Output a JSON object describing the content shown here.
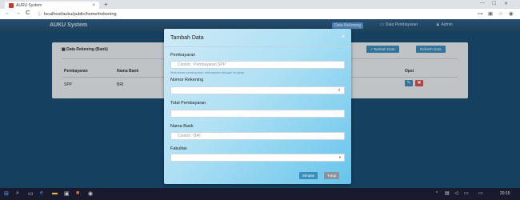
{
  "browser": {
    "tab_title": "AURU System",
    "tab_close": "×",
    "new_tab": "+",
    "url": "localhost/auku/public/home#rekening",
    "nav_back": "←",
    "nav_forward": "→",
    "nav_reload": "C"
  },
  "app": {
    "brand": "AUKU System",
    "nav": {
      "item1": "Data Rekening",
      "item2": "Data Pembayaran",
      "item3": "Admin"
    }
  },
  "panel": {
    "title": "Data Rekening (Bank)",
    "add_button": "+ Tambah Data",
    "refresh_button": "Refresh Data",
    "columns": [
      "Pembayaran",
      "Nama Bank",
      "Opsi"
    ],
    "rows": [
      {
        "pembayaran": "SPP",
        "bank": "BRI"
      }
    ]
  },
  "modal": {
    "title": "Tambah Data",
    "close": "×",
    "pembayaran_label": "Pembayaran",
    "pembayaran_placeholder": "Contoh : Pembayaran SPP",
    "pembayaran_help": "Masukkan pembayaran mahasiswa dengan lengkap",
    "rekening_label": "Nomor Rekening",
    "rekening_value": "",
    "total_label": "Total Pembayaran",
    "bank_label": "Nama Bank",
    "bank_placeholder": "Contoh : BRI",
    "fakultas_label": "Fakultas",
    "save_button": "Simpan",
    "close_button": "Tutup"
  },
  "taskbar": {
    "time": "20:15"
  },
  "colors": {
    "page_bg": "#1b4f74",
    "primary": "#3c8dbc",
    "danger": "#d9534f",
    "modal_gradient_end": "#67c4ec",
    "taskbar": "#1a1a2e"
  }
}
